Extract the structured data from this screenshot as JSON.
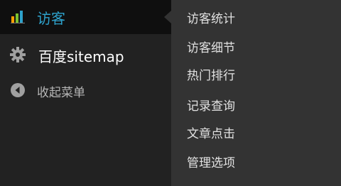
{
  "side_menu": {
    "current_item": {
      "label": "访客",
      "icon": "bar-chart-icon"
    },
    "sitemap_item": {
      "label": "百度sitemap",
      "icon": "gear-icon"
    },
    "collapse_item": {
      "label": "收起菜单",
      "icon": "collapse-arrow-icon"
    }
  },
  "submenu": {
    "items": [
      {
        "label": "访客统计"
      },
      {
        "label": "访客细节"
      },
      {
        "label": "热门排行"
      },
      {
        "label": "记录查询"
      },
      {
        "label": "文章点击"
      },
      {
        "label": "管理选项"
      }
    ]
  },
  "colors": {
    "menu_background": "#222222",
    "current_background": "#0f0f0f",
    "submenu_background": "#333333",
    "current_text": "#2ea2cc"
  }
}
